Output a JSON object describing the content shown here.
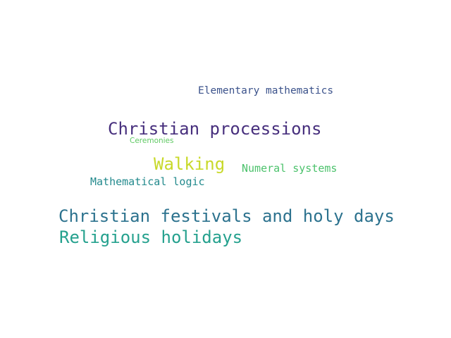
{
  "words": [
    {
      "text": "Elementary mathematics",
      "color": "#3b528b"
    },
    {
      "text": "Christian processions",
      "color": "#472f7d"
    },
    {
      "text": "Ceremonies",
      "color": "#5ec962"
    },
    {
      "text": "Walking",
      "color": "#c8d92a"
    },
    {
      "text": "Numeral systems",
      "color": "#4cc26c"
    },
    {
      "text": "Mathematical logic",
      "color": "#238a8d"
    },
    {
      "text": "Christian festivals and holy days",
      "color": "#2c728e"
    },
    {
      "text": "Religious holidays",
      "color": "#25a18e"
    }
  ]
}
